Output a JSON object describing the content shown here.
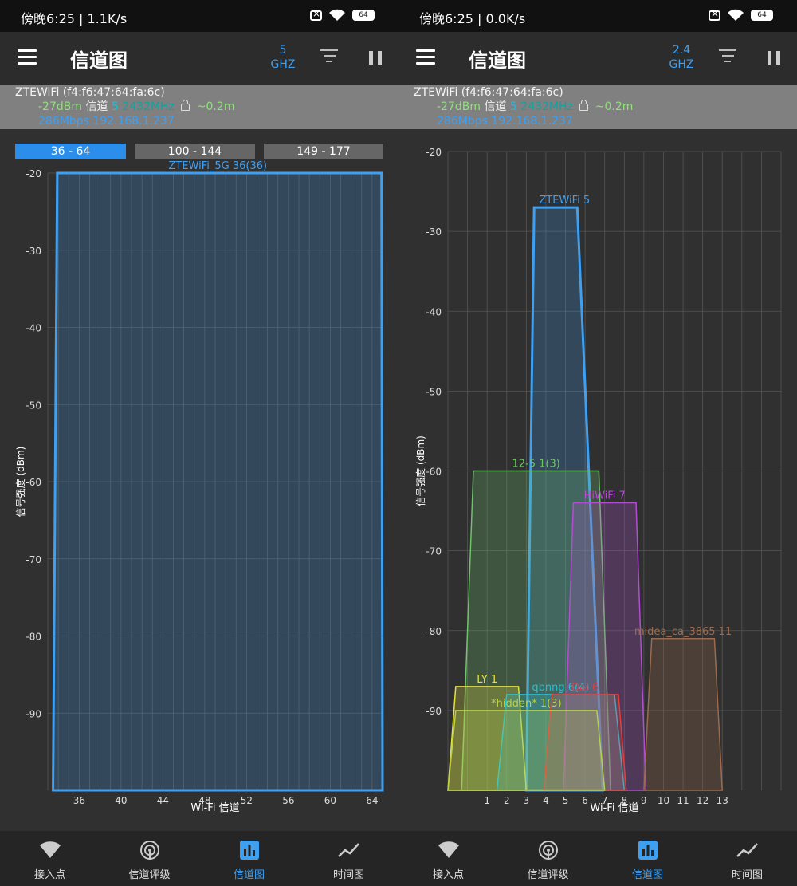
{
  "panels": [
    {
      "status": {
        "time": "傍晚6:25 | 1.1K/s",
        "battery": "64"
      },
      "toolbar": {
        "title": "信道图",
        "band_value": "5",
        "band_unit": "GHZ"
      },
      "info": {
        "ssid_mac": "ZTEWiFi (f4:f6:47:64:fa:6c)",
        "signal": "-27dBm",
        "channel_label": "信道",
        "channel": "5",
        "frequency": "2432MHz",
        "distance": "~0.2m",
        "rate_ip": "286Mbps 192.168.1.237"
      },
      "ranges": [
        {
          "label": "36 - 64",
          "active": true
        },
        {
          "label": "100 - 144",
          "active": false
        },
        {
          "label": "149 - 177",
          "active": false
        }
      ],
      "nav": [
        {
          "label": "接入点",
          "icon": "wifi-icon",
          "active": false
        },
        {
          "label": "信道评级",
          "icon": "signal-rating-icon",
          "active": false
        },
        {
          "label": "信道图",
          "icon": "bar-chart-icon",
          "active": true
        },
        {
          "label": "时间图",
          "icon": "line-chart-icon",
          "active": false
        }
      ]
    },
    {
      "status": {
        "time": "傍晚6:25 | 0.0K/s",
        "battery": "64"
      },
      "toolbar": {
        "title": "信道图",
        "band_value": "2.4",
        "band_unit": "GHZ"
      },
      "info": {
        "ssid_mac": "ZTEWiFi (f4:f6:47:64:fa:6c)",
        "signal": "-27dBm",
        "channel_label": "信道",
        "channel": "5",
        "frequency": "2432MHz",
        "distance": "~0.2m",
        "rate_ip": "286Mbps 192.168.1.237"
      },
      "nav": [
        {
          "label": "接入点",
          "icon": "wifi-icon",
          "active": false
        },
        {
          "label": "信道评级",
          "icon": "signal-rating-icon",
          "active": false
        },
        {
          "label": "信道图",
          "icon": "bar-chart-icon",
          "active": true
        },
        {
          "label": "时间图",
          "icon": "line-chart-icon",
          "active": false
        }
      ]
    }
  ],
  "chart_data": [
    {
      "type": "area",
      "xlabel": "Wi-Fi 信道",
      "ylabel": "信号强度 (dBm)",
      "ylim": [
        -100,
        -20
      ],
      "xlim": [
        33,
        65
      ],
      "yticks": [
        -20,
        -30,
        -40,
        -50,
        -60,
        -70,
        -80,
        -90
      ],
      "xticks": [
        36,
        40,
        44,
        48,
        52,
        56,
        60,
        64
      ],
      "grid": true,
      "series": [
        {
          "name": "ZTEWiFi_5G 36(36)",
          "color": "#3fa0f2",
          "points": [
            [
              33.5,
              -100
            ],
            [
              33.9,
              -20
            ],
            [
              64.9,
              -20
            ],
            [
              65,
              -100
            ]
          ]
        }
      ]
    },
    {
      "type": "area",
      "xlabel": "Wi-Fi 信道",
      "ylabel": "信号强度 (dBm)",
      "ylim": [
        -100,
        -20
      ],
      "xlim": [
        -1,
        16
      ],
      "yticks": [
        -20,
        -30,
        -40,
        -50,
        -60,
        -70,
        -80,
        -90
      ],
      "xticks": [
        1,
        2,
        3,
        4,
        5,
        6,
        7,
        8,
        9,
        10,
        11,
        12,
        13
      ],
      "grid": true,
      "series": [
        {
          "name": "ZTEWiFi 5",
          "color": "#3fa0f2",
          "points": [
            [
              3,
              -100
            ],
            [
              3.4,
              -27
            ],
            [
              5.6,
              -27
            ],
            [
              6.9,
              -100
            ]
          ]
        },
        {
          "name": "12-5 1(3)",
          "color": "#6fc36a",
          "points": [
            [
              -0.3,
              -100
            ],
            [
              0.3,
              -60
            ],
            [
              6.7,
              -60
            ],
            [
              7.3,
              -100
            ]
          ]
        },
        {
          "name": "HiWiFi 7",
          "color": "#b04fd0",
          "points": [
            [
              4.9,
              -100
            ],
            [
              5.4,
              -64
            ],
            [
              8.6,
              -64
            ],
            [
              9.1,
              -100
            ]
          ]
        },
        {
          "name": "midea_ca_3865 11",
          "color": "#9c6b4e",
          "points": [
            [
              9,
              -100
            ],
            [
              9.4,
              -81
            ],
            [
              12.6,
              -81
            ],
            [
              13,
              -100
            ]
          ]
        },
        {
          "name": "LY 1",
          "color": "#e8e040",
          "points": [
            [
              -1,
              -100
            ],
            [
              -0.6,
              -87
            ],
            [
              2.6,
              -87
            ],
            [
              3,
              -100
            ]
          ]
        },
        {
          "name": "qbnng 6(4)",
          "color": "#26c0d0",
          "points": [
            [
              1.5,
              -100
            ],
            [
              2.0,
              -88
            ],
            [
              7.5,
              -88
            ],
            [
              8,
              -100
            ]
          ]
        },
        {
          "name": "Dai 6",
          "color": "#e04040",
          "points": [
            [
              3.9,
              -100
            ],
            [
              4.3,
              -88
            ],
            [
              7.7,
              -88
            ],
            [
              8.1,
              -100
            ]
          ]
        },
        {
          "name": "*hidden* 1(3)",
          "color": "#b8d04a",
          "points": [
            [
              -1,
              -100
            ],
            [
              -0.6,
              -90
            ],
            [
              6.6,
              -90
            ],
            [
              7,
              -100
            ]
          ]
        }
      ]
    }
  ]
}
